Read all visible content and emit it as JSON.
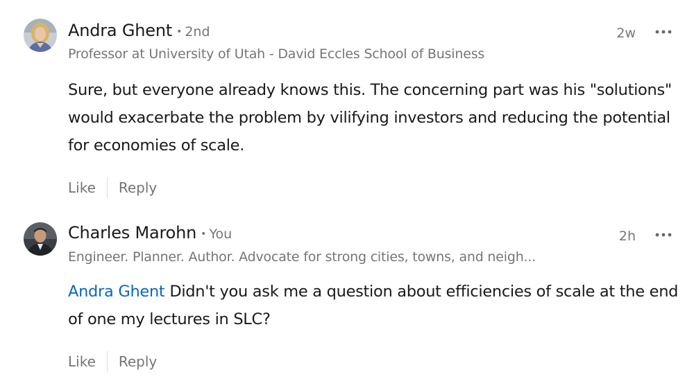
{
  "comments": [
    {
      "author": "Andra Ghent",
      "degree": "2nd",
      "headline": "Professor at University of Utah - David Eccles School of Business",
      "time": "2w",
      "body": "Sure, but everyone already knows this. The concerning part was his \"solutions\" would exacerbate the problem by vilifying investors and reducing the potential for economies of scale.",
      "like_label": "Like",
      "reply_label": "Reply"
    },
    {
      "author": "Charles Marohn",
      "degree": "You",
      "headline": "Engineer. Planner. Author. Advocate for strong cities, towns, and neigh...",
      "time": "2h",
      "mention": "Andra Ghent",
      "body": "Didn't you ask me a question about efficiencies of scale at the end of one my lectures in SLC?",
      "like_label": "Like",
      "reply_label": "Reply"
    }
  ],
  "colors": {
    "mention": "#0a66c2",
    "secondary_text": "#737373"
  },
  "icons": {
    "more": "more-horizontal-icon"
  }
}
